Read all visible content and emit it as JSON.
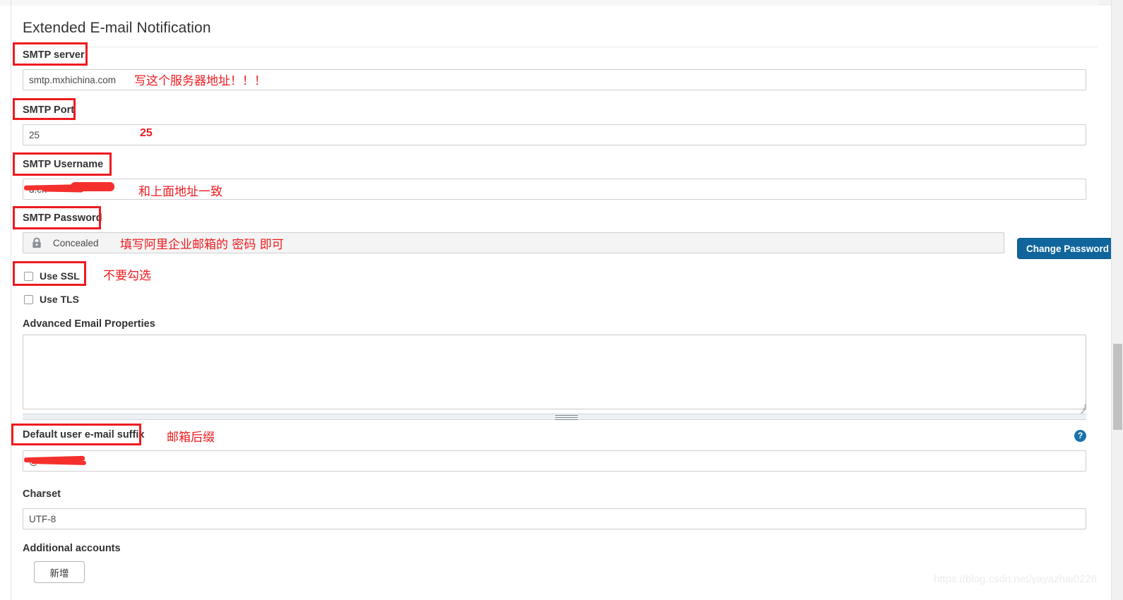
{
  "page": {
    "title": "Extended E-mail Notification",
    "watermark": "https://blog.csdn.net/yayazhai0226"
  },
  "fields": {
    "smtp_server": {
      "label": "SMTP server",
      "value": "smtp.mxhichina.com"
    },
    "smtp_port": {
      "label": "SMTP Port",
      "value": "25"
    },
    "smtp_username": {
      "label": "SMTP Username",
      "value": "d.cn"
    },
    "smtp_password": {
      "label": "SMTP Password",
      "value": "Concealed",
      "change_button": "Change Password",
      "lock_icon": "lock-icon"
    },
    "use_ssl": {
      "label": "Use SSL",
      "checked": false
    },
    "use_tls": {
      "label": "Use TLS",
      "checked": false
    },
    "advanced_email_properties": {
      "label": "Advanced Email Properties",
      "value": ""
    },
    "default_suffix": {
      "label": "Default user e-mail suffix",
      "value": "@",
      "help_icon": "help-icon",
      "help_glyph": "?"
    },
    "charset": {
      "label": "Charset",
      "value": "UTF-8"
    },
    "additional_accounts": {
      "label": "Additional accounts",
      "add_button": "新增"
    }
  },
  "annotations": [
    {
      "id": "a1",
      "text": "写这个服务器地址！！！"
    },
    {
      "id": "a2",
      "text": "25"
    },
    {
      "id": "a3",
      "text": "和上面地址一致"
    },
    {
      "id": "a4",
      "text": "填写阿里企业邮箱的 密码 即可"
    },
    {
      "id": "a5",
      "text": "不要勾选"
    },
    {
      "id": "a6",
      "text": "邮箱后缀"
    }
  ],
  "colors": {
    "annotation_red": "#ee1b20",
    "primary_blue": "#10659d",
    "help_blue": "#1a72ab",
    "border_grey": "#cfcfcf"
  }
}
